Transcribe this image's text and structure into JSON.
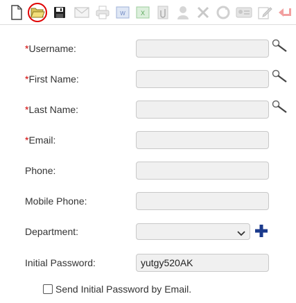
{
  "toolbar": {
    "items": [
      {
        "icon": "new-document-icon"
      },
      {
        "icon": "open-folder-icon",
        "highlighted": true
      },
      {
        "icon": "save-icon"
      },
      {
        "icon": "email-icon"
      },
      {
        "icon": "print-icon"
      },
      {
        "icon": "export-word-icon"
      },
      {
        "icon": "export-excel-icon"
      },
      {
        "icon": "attach-icon"
      },
      {
        "icon": "user-icon"
      },
      {
        "icon": "delete-icon"
      },
      {
        "icon": "refresh-icon"
      },
      {
        "icon": "id-card-icon"
      },
      {
        "icon": "edit-icon"
      },
      {
        "icon": "back-icon"
      }
    ],
    "highlight_color": "#e00000"
  },
  "form": {
    "username": {
      "required": "*",
      "label": "Username:",
      "value": ""
    },
    "first_name": {
      "required": "*",
      "label": "First Name:",
      "value": ""
    },
    "last_name": {
      "required": "*",
      "label": "Last Name:",
      "value": ""
    },
    "email": {
      "required": "*",
      "label": "Email:",
      "value": ""
    },
    "phone": {
      "label": "Phone:",
      "value": ""
    },
    "mobile_phone": {
      "label": "Mobile Phone:",
      "value": ""
    },
    "department": {
      "label": "Department:",
      "value": ""
    },
    "initial_password": {
      "label": "Initial Password:",
      "value": "yutgy520AK"
    },
    "send_password": {
      "label": "Send Initial Password by Email.",
      "checked": false
    }
  },
  "colors": {
    "required": "#d00000",
    "add_button": "#1b3a8c"
  }
}
